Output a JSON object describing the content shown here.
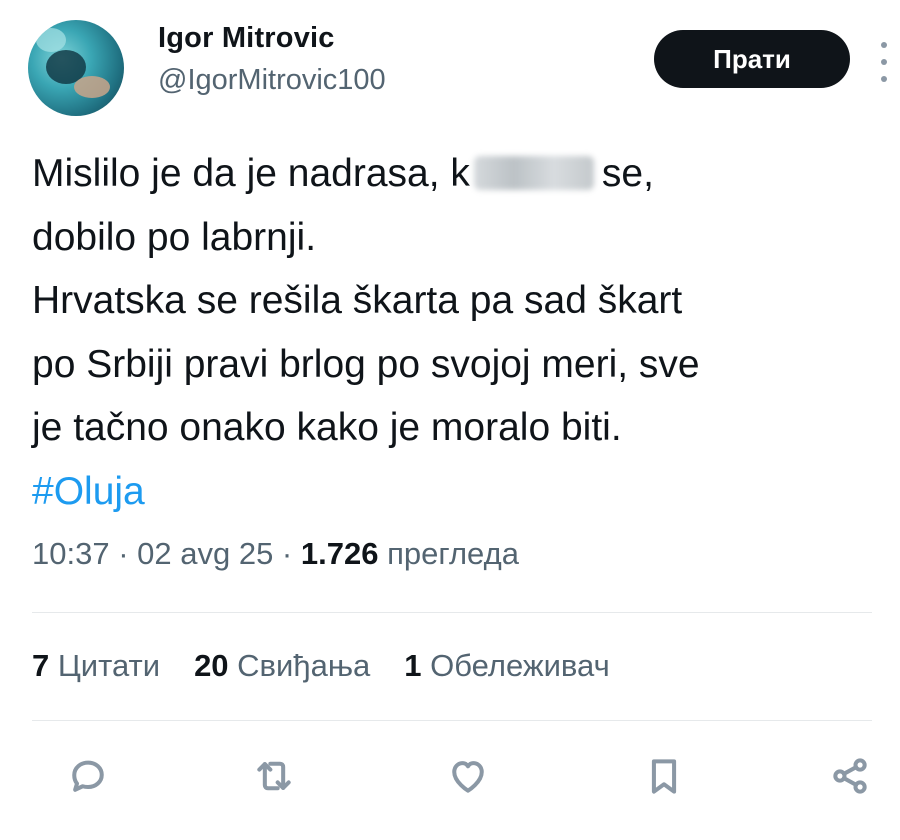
{
  "author": {
    "name": "Igor Mitrovic",
    "handle": "@IgorMitrovic100",
    "follow_label": "Прати"
  },
  "tweet": {
    "line1_before": "Mislilo je da je nadrasa, k",
    "line1_after": "se,",
    "line2": "dobilo po labrnji.",
    "line3": "Hrvatska se rešila škarta pa sad škart",
    "line4": "po Srbiji pravi brlog po svojoj meri, sve",
    "line5": "je tačno onako kako je moralo biti.",
    "hashtag": "#Oluja"
  },
  "meta": {
    "time": "10:37",
    "date": "02 avg 25",
    "views_count": "1.726",
    "views_label": "прегледа",
    "separator": " · "
  },
  "stats": {
    "quotes_count": "7",
    "quotes_label": "Цитати",
    "likes_count": "20",
    "likes_label": "Свиђања",
    "bookmarks_count": "1",
    "bookmarks_label": "Обележивач"
  },
  "icons": {
    "reply": "reply-icon",
    "retweet": "retweet-icon",
    "like": "heart-icon",
    "bookmark": "bookmark-icon",
    "share": "share-icon",
    "more": "more-icon"
  },
  "colors": {
    "text": "#0f1419",
    "secondary": "#536471",
    "hashtag": "#1d9bf0",
    "button": "#0f1419"
  }
}
